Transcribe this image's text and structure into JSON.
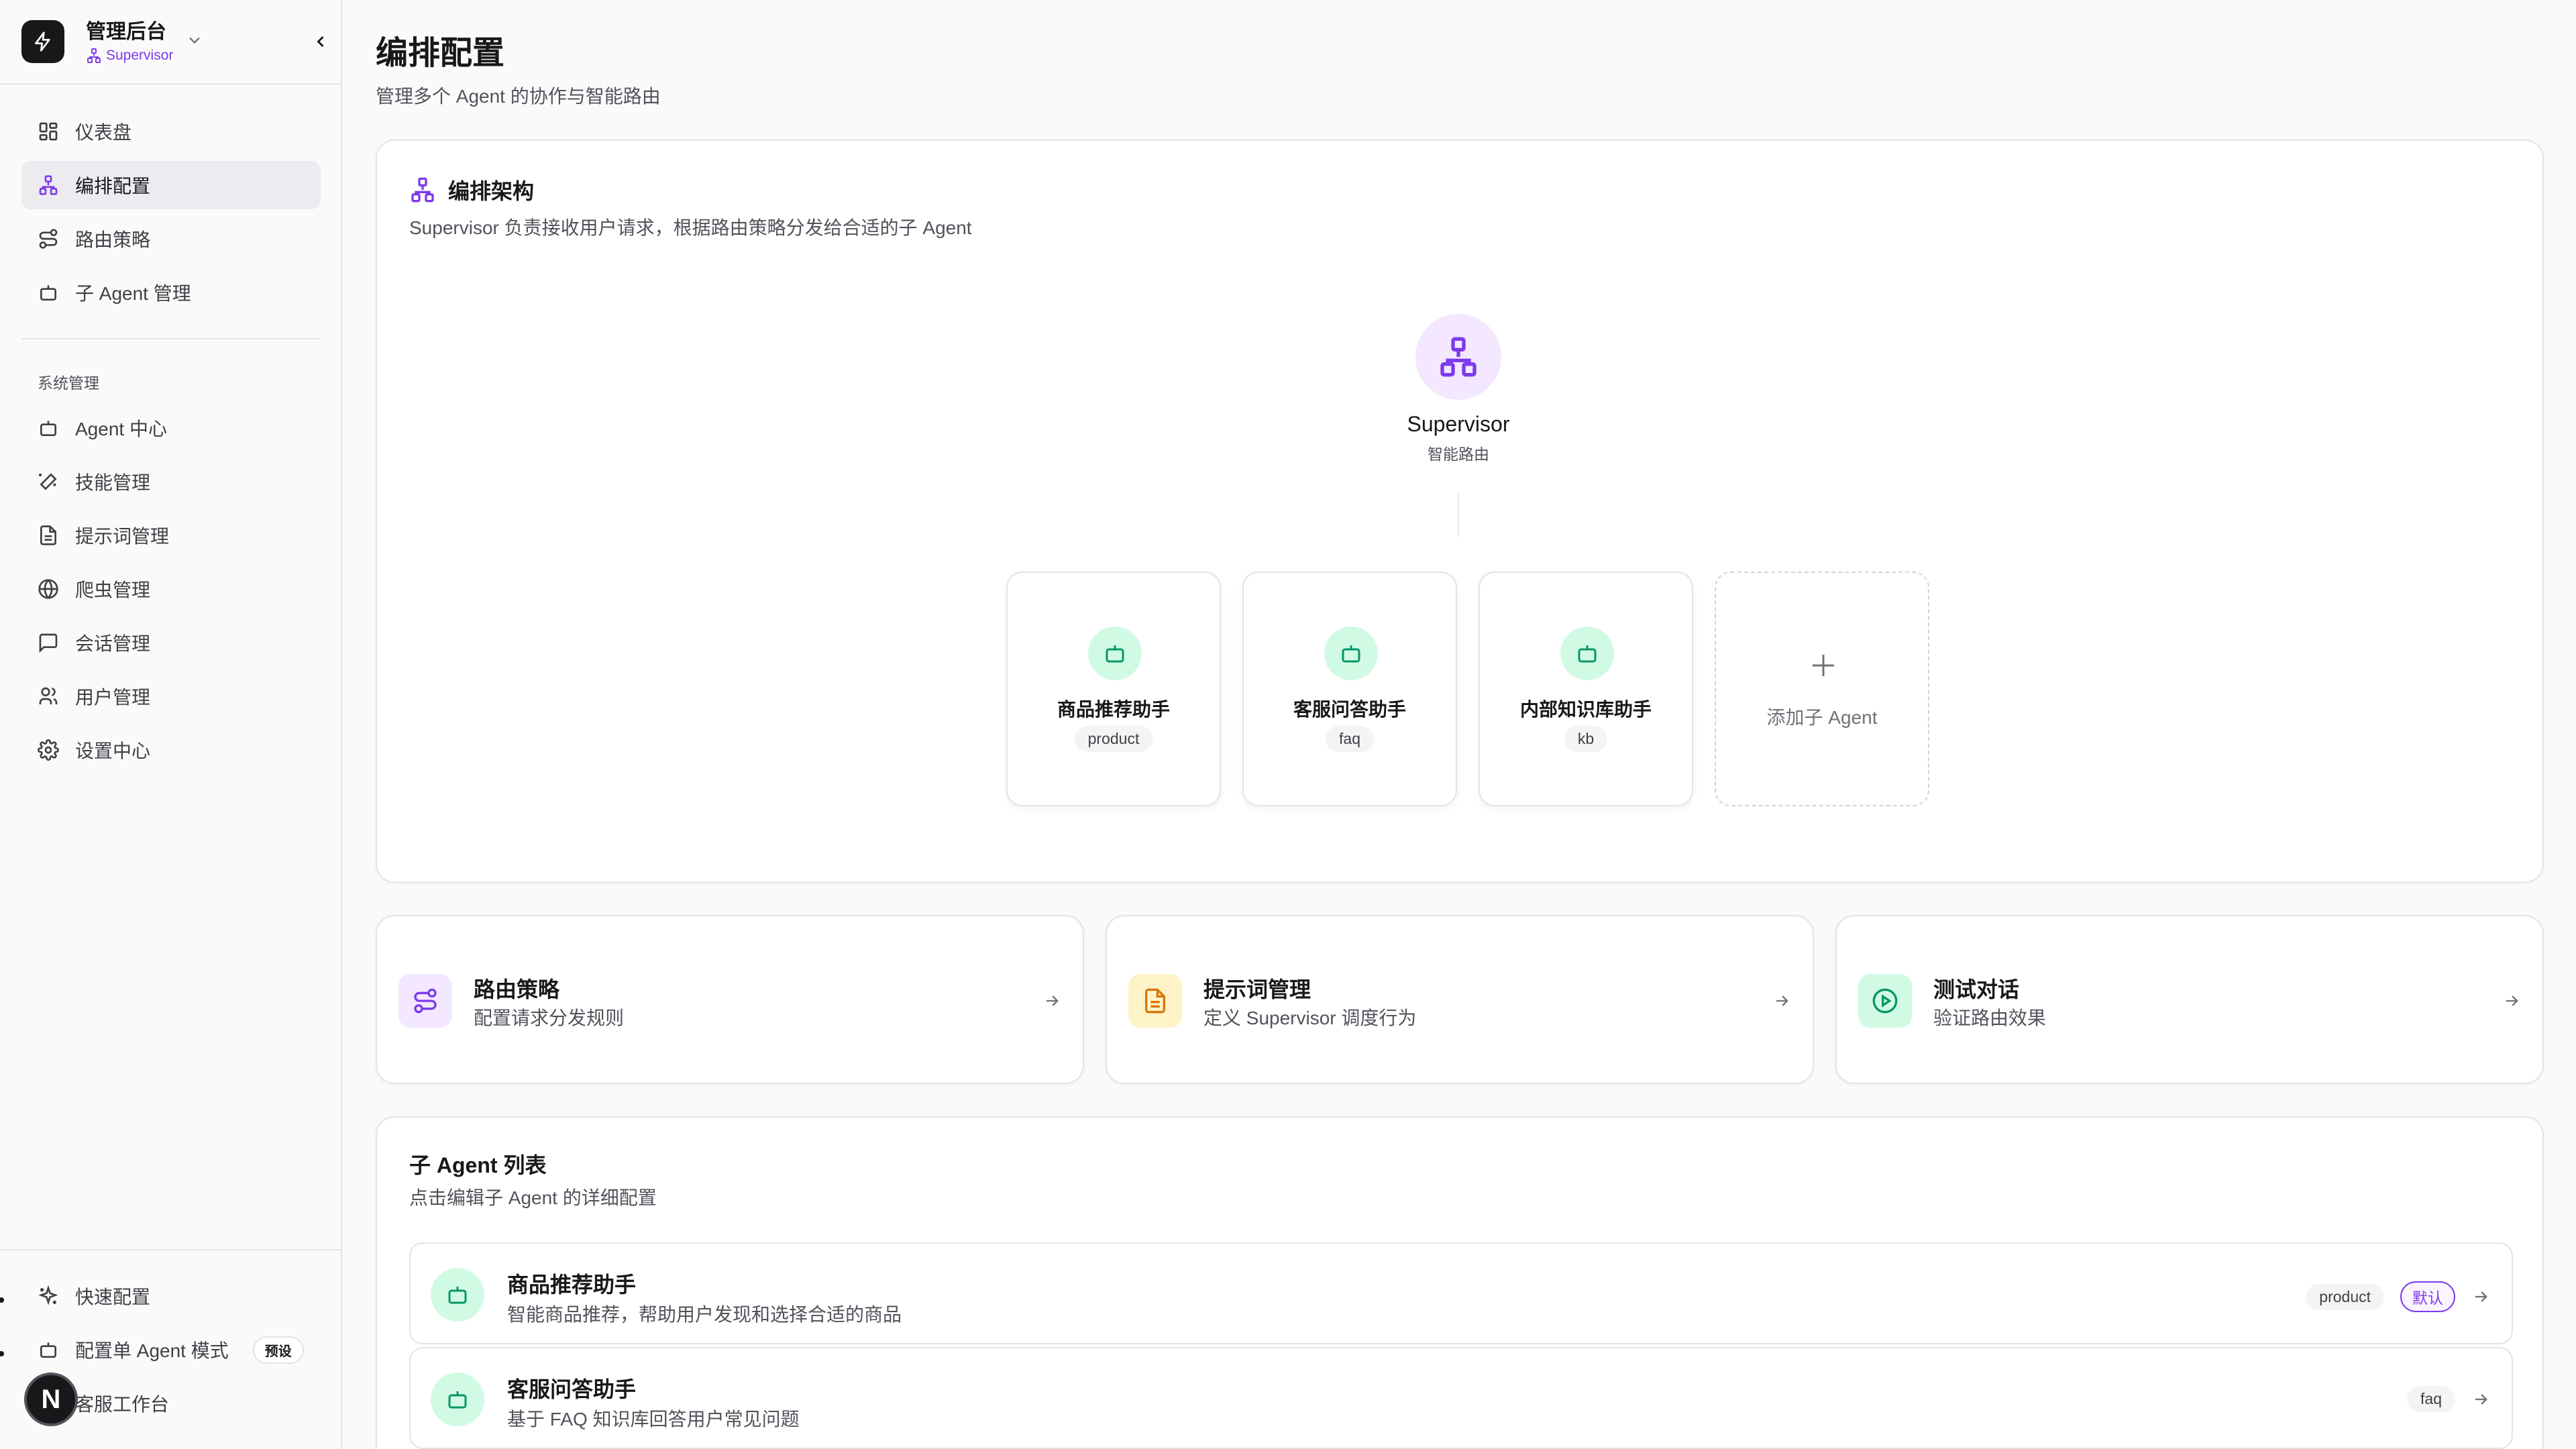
{
  "app": {
    "title": "管理后台",
    "subtitle": "Supervisor"
  },
  "sidebar": {
    "main_items": [
      {
        "label": "仪表盘",
        "icon": "dashboard-icon"
      },
      {
        "label": "编排配置",
        "icon": "network-icon",
        "active": true
      },
      {
        "label": "路由策略",
        "icon": "route-icon"
      },
      {
        "label": "子 Agent 管理",
        "icon": "bot-icon"
      }
    ],
    "section_label": "系统管理",
    "system_items": [
      {
        "label": "Agent 中心",
        "icon": "bot-icon"
      },
      {
        "label": "技能管理",
        "icon": "wand-icon"
      },
      {
        "label": "提示词管理",
        "icon": "document-icon"
      },
      {
        "label": "爬虫管理",
        "icon": "globe-icon"
      },
      {
        "label": "会话管理",
        "icon": "chat-icon"
      },
      {
        "label": "用户管理",
        "icon": "users-icon"
      },
      {
        "label": "设置中心",
        "icon": "gear-icon"
      }
    ],
    "bottom_items": [
      {
        "label": "快速配置",
        "icon": "sparkles-icon"
      },
      {
        "label": "配置单 Agent 模式",
        "icon": "bot-icon",
        "badge": "预设"
      },
      {
        "label": "客服工作台",
        "icon": "headset-icon"
      }
    ],
    "avatar_letter": "N"
  },
  "page": {
    "title": "编排配置",
    "subtitle": "管理多个 Agent 的协作与智能路由"
  },
  "architecture": {
    "title": "编排架构",
    "subtitle": "Supervisor 负责接收用户请求，根据路由策略分发给合适的子 Agent",
    "supervisor": {
      "name": "Supervisor",
      "desc": "智能路由"
    },
    "agents": [
      {
        "name": "商品推荐助手",
        "tag": "product"
      },
      {
        "name": "客服问答助手",
        "tag": "faq"
      },
      {
        "name": "内部知识库助手",
        "tag": "kb"
      }
    ],
    "add_label": "添加子 Agent"
  },
  "quick_links": [
    {
      "title": "路由策略",
      "desc": "配置请求分发规则",
      "icon": "route-icon",
      "color": "#7c3aed",
      "bg": "#f3e8ff"
    },
    {
      "title": "提示词管理",
      "desc": "定义 Supervisor 调度行为",
      "icon": "document-icon",
      "color": "#d97706",
      "bg": "#fef3c7"
    },
    {
      "title": "测试对话",
      "desc": "验证路由效果",
      "icon": "play-icon",
      "color": "#059669",
      "bg": "#d1fae5"
    }
  ],
  "agent_list": {
    "title": "子 Agent 列表",
    "subtitle": "点击编辑子 Agent 的详细配置",
    "items": [
      {
        "name": "商品推荐助手",
        "desc": "智能商品推荐，帮助用户发现和选择合适的商品",
        "tag": "product",
        "default_label": "默认"
      },
      {
        "name": "客服问答助手",
        "desc": "基于 FAQ 知识库回答用户常见问题",
        "tag": "faq"
      }
    ]
  }
}
